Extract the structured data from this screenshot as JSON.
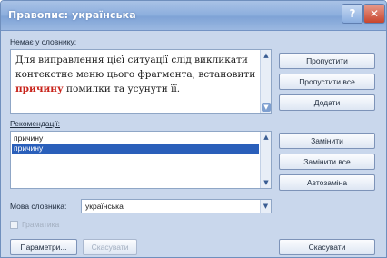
{
  "window": {
    "title": "Правопис: українська",
    "help_glyph": "?",
    "close_glyph": "✕"
  },
  "not_in_dictionary": {
    "label": "Немає у словнику:",
    "text_before": "Для виправлення цієї ситуації слід викликати контекстне меню цього фрагмента, встановити ",
    "error_word": "причину",
    "text_after": " помилки та усунути її."
  },
  "suggestions": {
    "label": "Рекомендації:",
    "items": [
      "причину",
      "причину"
    ],
    "selected_index": 1
  },
  "buttons": {
    "ignore_once": "Пропустити",
    "ignore_all": "Пропустити все",
    "add": "Додати",
    "change": "Замінити",
    "change_all": "Замінити все",
    "autocorrect": "Автозаміна",
    "options": "Параметри...",
    "undo": "Скасувати",
    "cancel": "Скасувати"
  },
  "dictionary_language": {
    "label": "Мова словника:",
    "value": "українська"
  },
  "grammar": {
    "label": "Граматика",
    "checked": false,
    "enabled": false
  },
  "colors": {
    "error_word": "#c8231a",
    "selection": "#2a5fba",
    "title_bar": "#8fb0de"
  },
  "icons": {
    "scroll_up": "scroll-up-arrow-icon",
    "scroll_down": "scroll-down-arrow-icon",
    "combo": "chevron-down-icon"
  }
}
